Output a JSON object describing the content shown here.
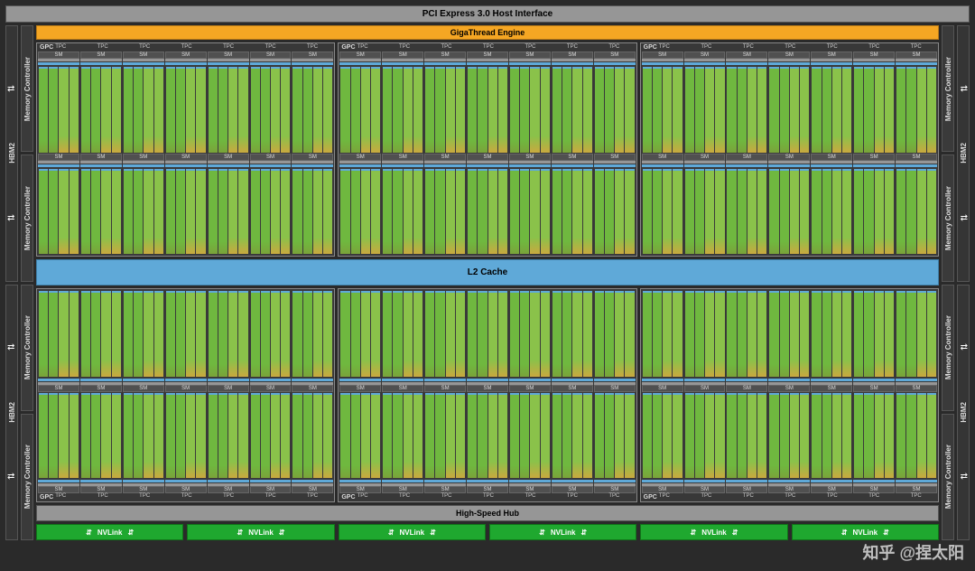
{
  "pci_label": "PCI Express 3.0 Host Interface",
  "gigathread_label": "GigaThread Engine",
  "hbm2_label": "HBM2",
  "memctrl_label": "Memory Controller",
  "gpc_label": "GPC",
  "tpc_label": "TPC",
  "sm_label": "SM",
  "l2_label": "L2 Cache",
  "hshub_label": "High-Speed Hub",
  "nvlink_label": "NVLink",
  "watermark": "知乎 @捏太阳",
  "counts": {
    "gpc_per_row": 3,
    "gpc_rows": 2,
    "tpc_per_gpc": 7,
    "sm_per_tpc": 2,
    "hbm2_per_side": 2,
    "memctrl_per_side": 4,
    "nvlinks": 6,
    "core_cols_per_sm": 4
  },
  "colors": {
    "giga": "#f5a623",
    "l2": "#5fa9d8",
    "nvlink": "#1fa82f",
    "core": "#6fb83f",
    "grey": "#969696"
  }
}
